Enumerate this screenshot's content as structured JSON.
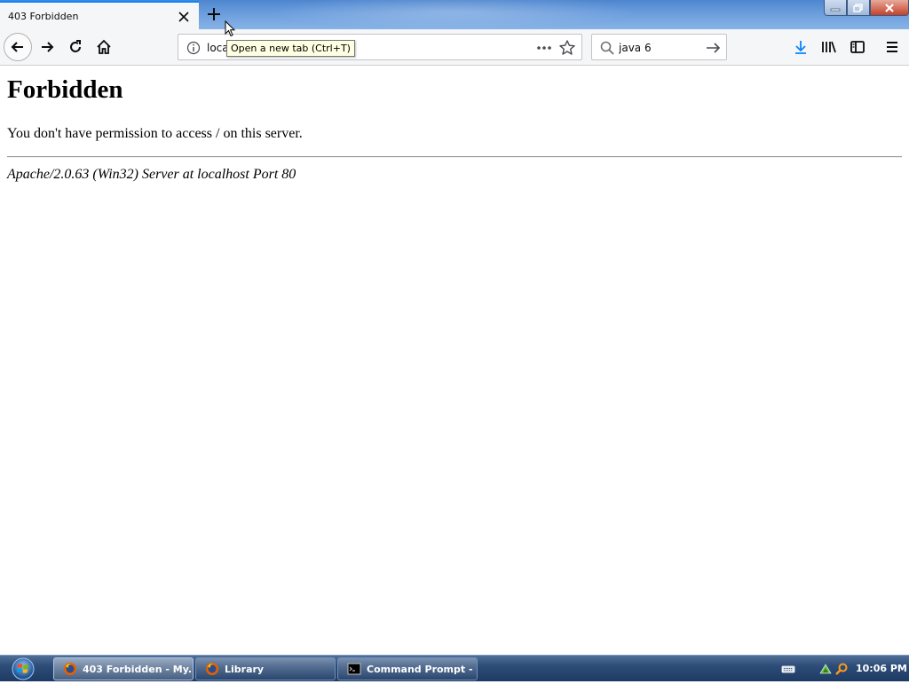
{
  "browser": {
    "tab": {
      "title": "403 Forbidden",
      "close_icon": "close-icon"
    },
    "new_tab_tooltip": "Open a new tab (Ctrl+T)",
    "url": "loca",
    "search": {
      "value": "java 6",
      "placeholder": ""
    },
    "icons": {
      "back": "back-arrow-icon",
      "forward": "forward-arrow-icon",
      "reload": "reload-icon",
      "home": "home-icon",
      "site_info": "info-icon",
      "page_actions": "more-dots-icon",
      "bookmark": "star-icon",
      "downloads": "download-icon",
      "library": "library-icon",
      "sidebar": "sidebar-icon",
      "menu": "hamburger-menu-icon"
    }
  },
  "page": {
    "heading": "Forbidden",
    "message": "You don't have permission to access / on this server.",
    "address": "Apache/2.0.63 (Win32) Server at localhost Port 80"
  },
  "taskbar": {
    "items": [
      {
        "label": "403 Forbidden - My...",
        "active": true
      },
      {
        "label": "Library",
        "active": false
      },
      {
        "label": "Command Prompt - ...",
        "active": false
      }
    ],
    "clock": "10:06 PM"
  },
  "colors": {
    "accent": "#0a84ff",
    "toolbar": "#f5f6f7",
    "tooltip_bg": "#ffffe1",
    "taskbar": "#2d4d78",
    "download_icon": "#0a84ff"
  }
}
